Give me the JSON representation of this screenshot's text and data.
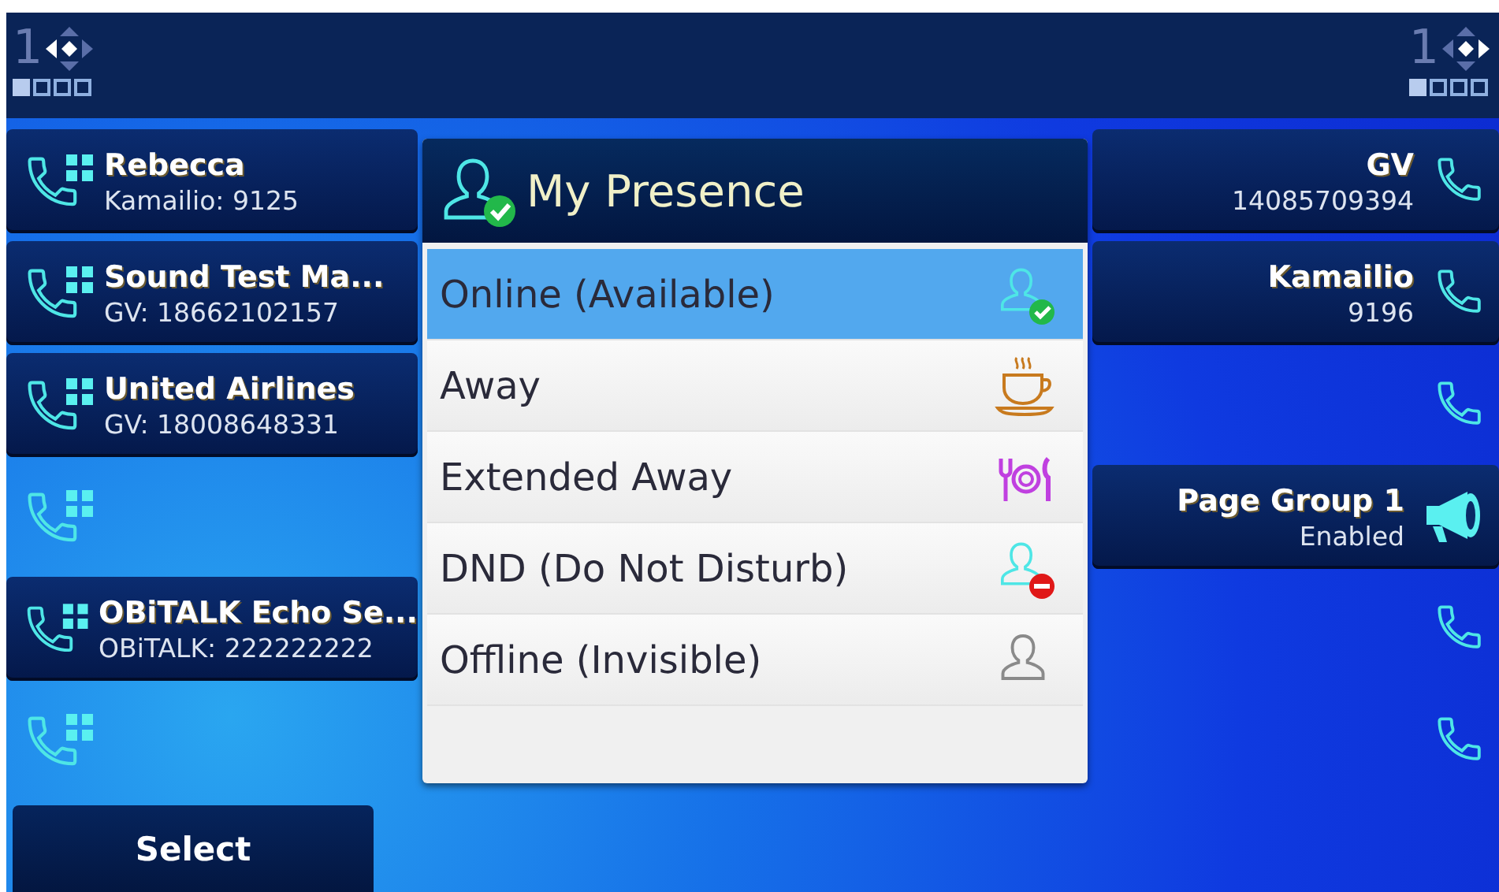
{
  "header": {
    "left_indicator": {
      "number": "1",
      "pages": [
        {
          "selected": true
        },
        {
          "selected": false
        },
        {
          "selected": false
        },
        {
          "selected": false
        }
      ]
    },
    "right_indicator": {
      "number": "1",
      "pages": [
        {
          "selected": true
        },
        {
          "selected": false
        },
        {
          "selected": false
        },
        {
          "selected": false
        }
      ]
    }
  },
  "left_keys": [
    {
      "kind": "line",
      "name": "Rebecca",
      "detail": "Kamailio: 9125"
    },
    {
      "kind": "line",
      "name": "Sound Test Ma...",
      "detail": "GV: 18662102157"
    },
    {
      "kind": "line",
      "name": "United Airlines",
      "detail": "GV: 18008648331"
    },
    {
      "kind": "line"
    },
    {
      "kind": "line",
      "name": "OBiTALK Echo Se...",
      "detail": "OBiTALK: 222222222"
    },
    {
      "kind": "line"
    }
  ],
  "presence_menu": {
    "title": "My Presence",
    "items": [
      {
        "kind": "online",
        "label": "Online (Available)",
        "selected": true
      },
      {
        "kind": "away",
        "label": "Away",
        "selected": false
      },
      {
        "kind": "extended_away",
        "label": "Extended Away",
        "selected": false
      },
      {
        "kind": "dnd",
        "label": "DND (Do Not Disturb)",
        "selected": false
      },
      {
        "kind": "offline",
        "label": "Offline (Invisible)",
        "selected": false
      }
    ]
  },
  "right_keys": [
    {
      "kind": "speed",
      "name": "GV",
      "detail": "14085709394"
    },
    {
      "kind": "speed",
      "name": "Kamailio",
      "detail": "9196"
    },
    {
      "kind": "speed"
    },
    {
      "kind": "paging",
      "name": "Page Group 1",
      "detail": "Enabled"
    },
    {
      "kind": "speed"
    },
    {
      "kind": "speed"
    }
  ],
  "softkeys": [
    "Select"
  ]
}
